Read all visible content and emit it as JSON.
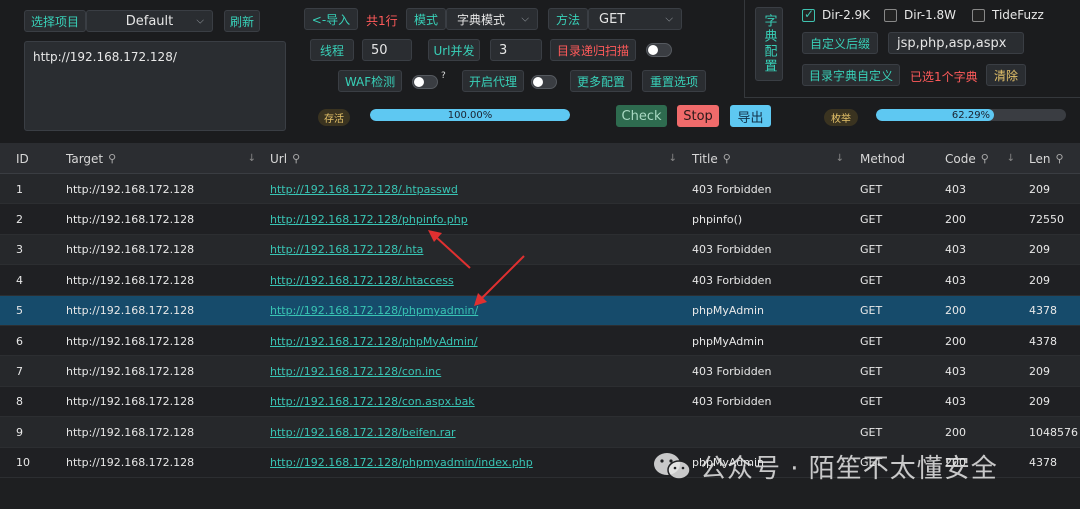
{
  "top": {
    "select_project_label": "选择项目",
    "project_value": "Default",
    "refresh_label": "刷新",
    "target_text": "http://192.168.172.128/",
    "import_label": "<-导入",
    "count_label": "共1行",
    "mode_label": "模式",
    "mode_value": "字典模式",
    "method_label": "方法",
    "method_value": "GET",
    "threads_label": "线程",
    "threads_value": "50",
    "url_concurrency_label": "Url并发",
    "url_concurrency_value": "3",
    "recursive_label": "目录递归扫描",
    "waf_label": "WAF检测",
    "waf_help": "?",
    "proxy_label": "开启代理",
    "more_config_label": "更多配置",
    "reset_label": "重置选项",
    "alive_label": "存活",
    "alive_progress": 100,
    "alive_progress_text": "100.00%",
    "check_label": "Check",
    "stop_label": "Stop",
    "export_label": "导出",
    "enum_label": "枚举",
    "enum_progress": 62.29,
    "enum_progress_text": "62.29%"
  },
  "dict": {
    "title": "字典配置",
    "options": [
      {
        "label": "Dir-2.9K",
        "checked": true
      },
      {
        "label": "Dir-1.8W",
        "checked": false
      },
      {
        "label": "TideFuzz",
        "checked": false
      }
    ],
    "custom_suffix_label": "自定义后缀",
    "suffix_value": "jsp,php,asp,aspx",
    "custom_dict_label": "目录字典自定义",
    "selected_text": "已选1个字典",
    "clear_label": "清除"
  },
  "table": {
    "headers": {
      "id": "ID",
      "target": "Target",
      "url": "Url",
      "title": "Title",
      "method": "Method",
      "code": "Code",
      "len": "Len"
    },
    "rows": [
      {
        "id": "1",
        "target": "http://192.168.172.128",
        "url": "http://192.168.172.128/.htpasswd",
        "title": "403 Forbidden",
        "method": "GET",
        "code": "403",
        "len": "209"
      },
      {
        "id": "2",
        "target": "http://192.168.172.128",
        "url": "http://192.168.172.128/phpinfo.php",
        "title": "phpinfo()",
        "method": "GET",
        "code": "200",
        "len": "72550"
      },
      {
        "id": "3",
        "target": "http://192.168.172.128",
        "url": "http://192.168.172.128/.hta",
        "title": "403 Forbidden",
        "method": "GET",
        "code": "403",
        "len": "209"
      },
      {
        "id": "4",
        "target": "http://192.168.172.128",
        "url": "http://192.168.172.128/.htaccess",
        "title": "403 Forbidden",
        "method": "GET",
        "code": "403",
        "len": "209"
      },
      {
        "id": "5",
        "target": "http://192.168.172.128",
        "url": "http://192.168.172.128/phpmyadmin/",
        "title": "phpMyAdmin",
        "method": "GET",
        "code": "200",
        "len": "4378",
        "selected": true
      },
      {
        "id": "6",
        "target": "http://192.168.172.128",
        "url": "http://192.168.172.128/phpMyAdmin/",
        "title": "phpMyAdmin",
        "method": "GET",
        "code": "200",
        "len": "4378"
      },
      {
        "id": "7",
        "target": "http://192.168.172.128",
        "url": "http://192.168.172.128/con.inc",
        "title": "403 Forbidden",
        "method": "GET",
        "code": "403",
        "len": "209"
      },
      {
        "id": "8",
        "target": "http://192.168.172.128",
        "url": "http://192.168.172.128/con.aspx.bak",
        "title": "403 Forbidden",
        "method": "GET",
        "code": "403",
        "len": "209"
      },
      {
        "id": "9",
        "target": "http://192.168.172.128",
        "url": "http://192.168.172.128/beifen.rar",
        "title": "",
        "method": "GET",
        "code": "200",
        "len": "1048576"
      },
      {
        "id": "10",
        "target": "http://192.168.172.128",
        "url": "http://192.168.172.128/phpmyadmin/index.php",
        "title": "phpMyAdmin",
        "method": "GET",
        "code": "200",
        "len": "4378"
      }
    ]
  },
  "watermark": {
    "text": "公众号 · 陌笙不太懂安全"
  },
  "colors": {
    "accent_teal": "#38d0b8",
    "stop_red": "#f06b6b",
    "check_green": "#2e6b4f",
    "export_blue": "#5ec8f2",
    "progress_blue": "#5ec8f2",
    "selected_row": "#164b6b",
    "annotation_arrow": "#e03030"
  }
}
